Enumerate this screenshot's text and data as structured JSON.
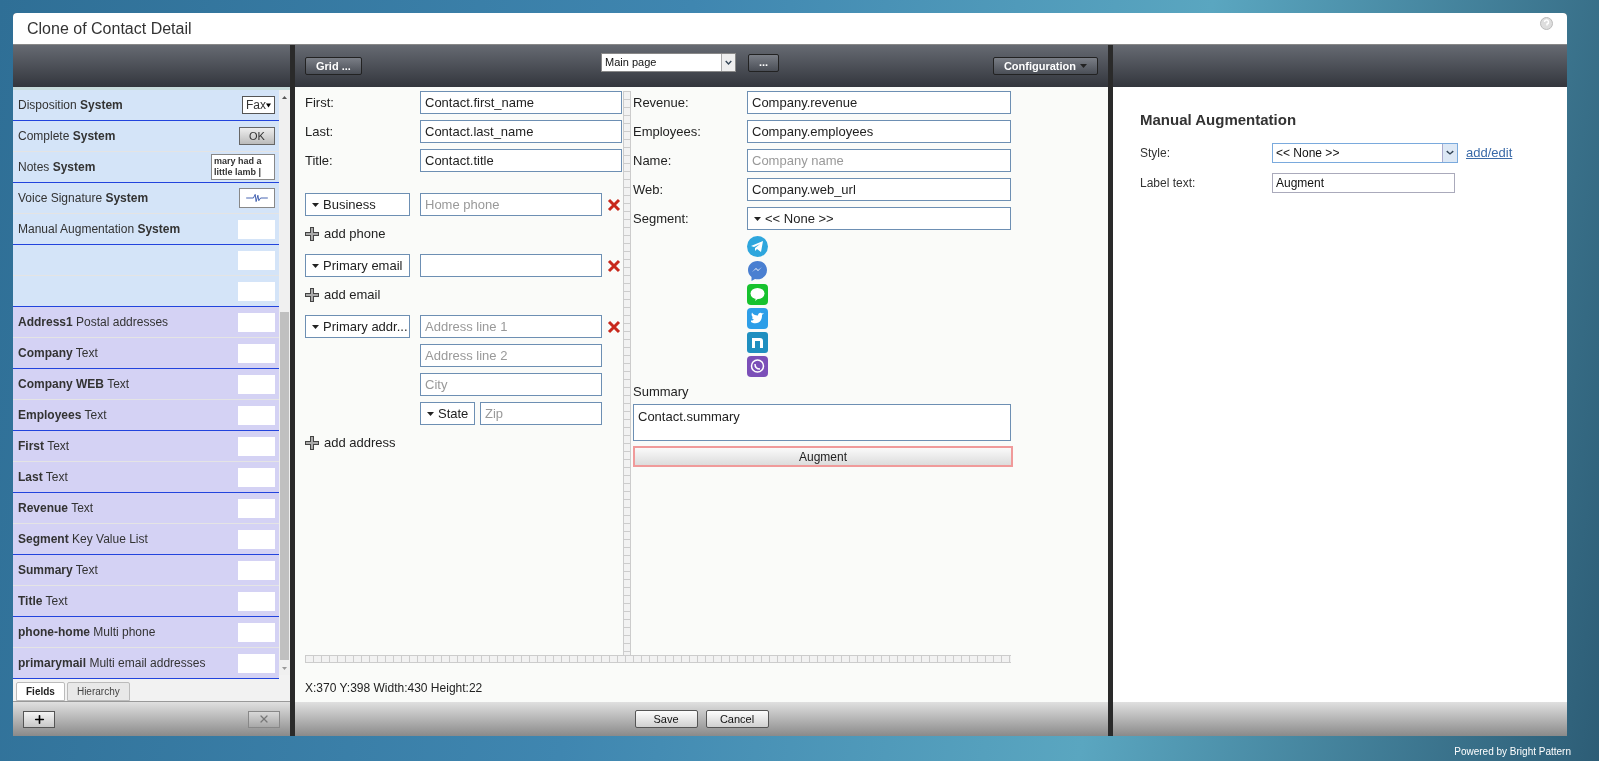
{
  "window": {
    "title": "Clone of Contact Detail"
  },
  "fields_panel": {
    "items": [
      {
        "color": "#d4e4f8",
        "label": "Disposition **System**",
        "kind": "dropdown",
        "preview_text": "Fax"
      },
      {
        "color": "#d4e4f8",
        "label": "Complete **System**",
        "kind": "button",
        "preview_text": "OK"
      },
      {
        "color": "#d4e4f8",
        "label": "Notes **System**",
        "kind": "notes",
        "preview_text": "mary had a little lamb |"
      },
      {
        "color": "#d4e4f8",
        "label": "Voice Signature **System**",
        "kind": "wave"
      },
      {
        "color": "#d4e4f8",
        "label": "Manual Augmentation **System**",
        "kind": "blank"
      },
      {
        "color": "#d4e4f8",
        "kind": "blank"
      },
      {
        "color": "#d4e4f8",
        "kind": "blank"
      },
      {
        "color": "#d4d2f4",
        "label": "**Address1** Postal addresses",
        "kind": "blank"
      },
      {
        "color": "#d4d2f4",
        "label": "**Company** Text",
        "kind": "blank"
      },
      {
        "color": "#d4d2f4",
        "label": "**Company WEB** Text",
        "kind": "blank"
      },
      {
        "color": "#d4d2f4",
        "label": "**Employees** Text",
        "kind": "blank"
      },
      {
        "color": "#d4d2f4",
        "label": "**First** Text",
        "kind": "blank"
      },
      {
        "color": "#d4d2f4",
        "label": "**Last** Text",
        "kind": "blank"
      },
      {
        "color": "#d4d2f4",
        "label": "**Revenue** Text",
        "kind": "blank"
      },
      {
        "color": "#d4d2f4",
        "label": "**Segment** Key Value List",
        "kind": "blank"
      },
      {
        "color": "#d4d2f4",
        "label": "**Summary** Text",
        "kind": "blank"
      },
      {
        "color": "#d4d2f4",
        "label": "**Title** Text",
        "kind": "blank"
      },
      {
        "color": "#d4d2f4",
        "label": "**phone-home** Multi phone",
        "kind": "blank"
      },
      {
        "color": "#d4d2f4",
        "label": "**primarymail** Multi email addresses",
        "kind": "blank"
      }
    ],
    "tabs": [
      {
        "label": "Fields",
        "selected": true
      },
      {
        "label": "Hierarchy",
        "selected": false
      }
    ]
  },
  "toolbar": {
    "grid_button": "Grid ...",
    "page_select": "Main page",
    "more_button": "...",
    "config_button": "Configuration"
  },
  "form": {
    "contact_fields": [
      {
        "label": "First:",
        "value": "Contact.first_name"
      },
      {
        "label": "Last:",
        "value": "Contact.last_name"
      },
      {
        "label": "Title:",
        "value": "Contact.title"
      }
    ],
    "multi_groups": [
      {
        "type_label": "Business",
        "lines": [
          {
            "kind": "input",
            "placeholder": "Home phone"
          }
        ],
        "add_label": "add phone"
      },
      {
        "type_label": "Primary email",
        "lines": [
          {
            "kind": "input"
          }
        ],
        "add_label": "add email"
      },
      {
        "type_label": "Primary addr...",
        "lines": [
          {
            "kind": "input",
            "placeholder": "Address line 1"
          },
          {
            "kind": "input",
            "placeholder": "Address line 2"
          },
          {
            "kind": "input",
            "placeholder": "City"
          },
          {
            "kind": "state_zip",
            "select": "State",
            "placeholder": "Zip"
          }
        ],
        "add_label": "add address"
      }
    ],
    "company_fields": [
      {
        "kind": "input",
        "label": "Revenue:",
        "value": "Company.revenue"
      },
      {
        "kind": "input",
        "label": "Employees:",
        "value": "Company.employees"
      },
      {
        "kind": "input",
        "label": "Name:",
        "placeholder": "Company name"
      },
      {
        "kind": "input",
        "label": "Web:",
        "value": "Company.web_url"
      },
      {
        "kind": "select",
        "label": "Segment:",
        "value": "<< None >>"
      }
    ],
    "summary": {
      "label": "Summary",
      "value": "Contact.summary"
    },
    "augment_button": {
      "label": "Augment",
      "selected": true
    }
  },
  "status": "X:370 Y:398 Width:430 Height:22",
  "footer_buttons": [
    "Save",
    "Cancel"
  ],
  "properties": {
    "title": "Manual Augmentation",
    "style": {
      "label": "Style:",
      "value": "<< None >>",
      "link": "add/edit"
    },
    "label_text": {
      "label": "Label text:",
      "value": "Augment"
    }
  },
  "powered_by": "Powered by Bright Pattern"
}
